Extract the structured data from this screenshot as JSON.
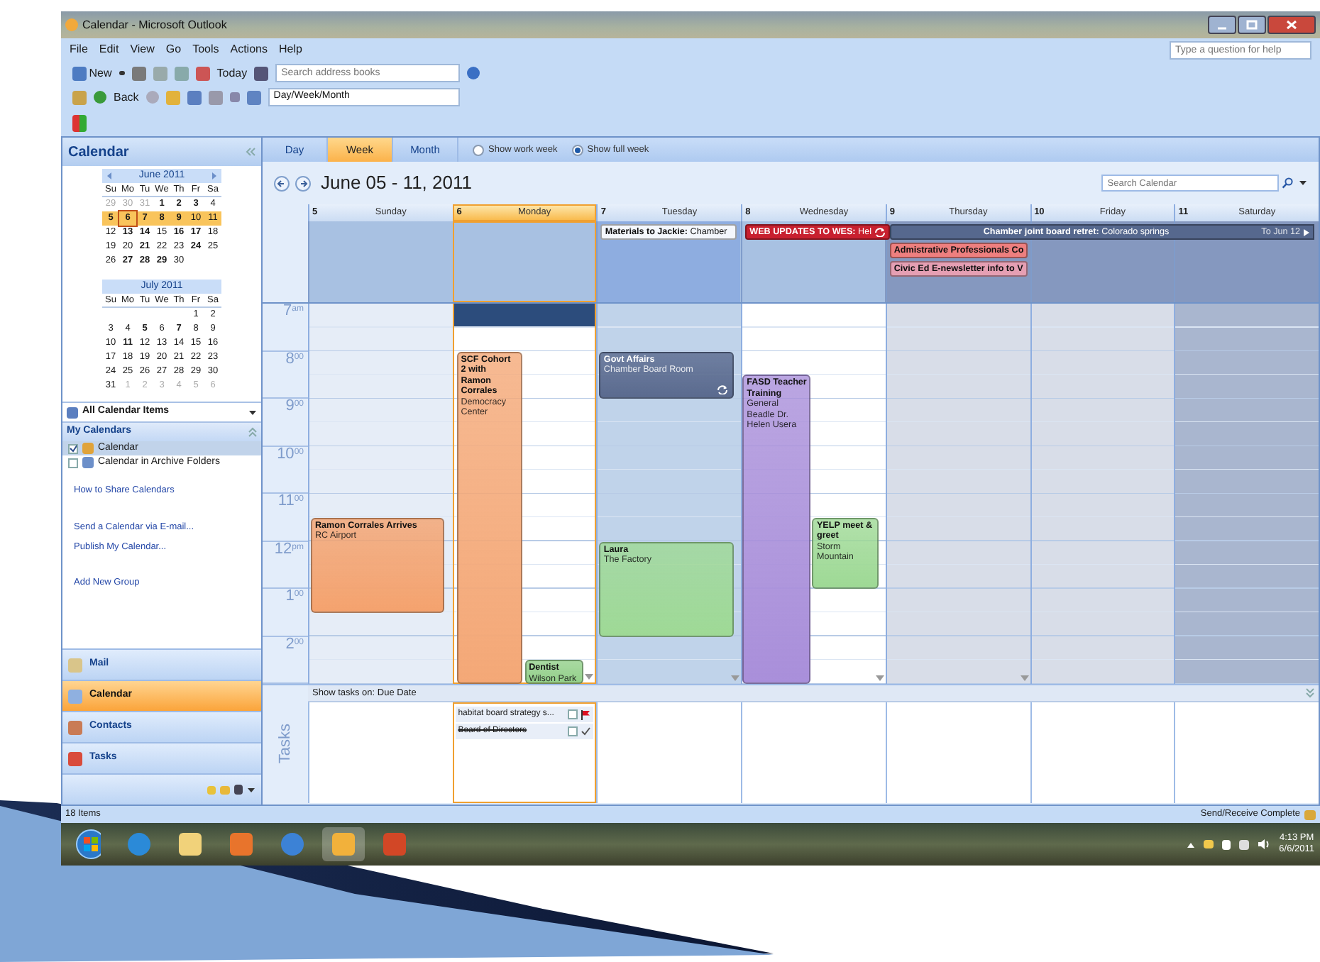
{
  "window": {
    "title": "Calendar - Microsoft Outlook"
  },
  "menu": [
    "File",
    "Edit",
    "View",
    "Go",
    "Tools",
    "Actions",
    "Help"
  ],
  "help_search": {
    "placeholder": "Type a question for help"
  },
  "toolbar_1": {
    "new": "New",
    "today": "Today",
    "address_search": {
      "placeholder": "Search address books"
    }
  },
  "toolbar_2": {
    "back": "Back",
    "view_select": "Day/Week/Month"
  },
  "nav_pane": {
    "title": "Calendar",
    "mini_calendars": [
      {
        "month": "June 2011",
        "weekdays": [
          "Su",
          "Mo",
          "Tu",
          "We",
          "Th",
          "Fr",
          "Sa"
        ],
        "weeks": [
          {
            "selected": false,
            "days": [
              {
                "day": "29",
                "muted": true,
                "bold": false,
                "today": false
              },
              {
                "day": "30",
                "muted": true,
                "bold": false,
                "today": false
              },
              {
                "day": "31",
                "muted": true,
                "bold": false,
                "today": false
              },
              {
                "day": "1",
                "muted": false,
                "bold": true,
                "today": false
              },
              {
                "day": "2",
                "muted": false,
                "bold": true,
                "today": false
              },
              {
                "day": "3",
                "muted": false,
                "bold": true,
                "today": false
              },
              {
                "day": "4",
                "muted": false,
                "bold": false,
                "today": false
              }
            ]
          },
          {
            "selected": true,
            "days": [
              {
                "day": "5",
                "muted": false,
                "bold": true,
                "today": false
              },
              {
                "day": "6",
                "muted": false,
                "bold": true,
                "today": true
              },
              {
                "day": "7",
                "muted": false,
                "bold": true,
                "today": false
              },
              {
                "day": "8",
                "muted": false,
                "bold": true,
                "today": false
              },
              {
                "day": "9",
                "muted": false,
                "bold": true,
                "today": false
              },
              {
                "day": "10",
                "muted": false,
                "bold": false,
                "today": false
              },
              {
                "day": "11",
                "muted": false,
                "bold": false,
                "today": false
              }
            ]
          },
          {
            "selected": false,
            "days": [
              {
                "day": "12",
                "muted": false,
                "bold": false,
                "today": false
              },
              {
                "day": "13",
                "muted": false,
                "bold": true,
                "today": false
              },
              {
                "day": "14",
                "muted": false,
                "bold": true,
                "today": false
              },
              {
                "day": "15",
                "muted": false,
                "bold": false,
                "today": false
              },
              {
                "day": "16",
                "muted": false,
                "bold": true,
                "today": false
              },
              {
                "day": "17",
                "muted": false,
                "bold": true,
                "today": false
              },
              {
                "day": "18",
                "muted": false,
                "bold": false,
                "today": false
              }
            ]
          },
          {
            "selected": false,
            "days": [
              {
                "day": "19",
                "muted": false,
                "bold": false,
                "today": false
              },
              {
                "day": "20",
                "muted": false,
                "bold": false,
                "today": false
              },
              {
                "day": "21",
                "muted": false,
                "bold": true,
                "today": false
              },
              {
                "day": "22",
                "muted": false,
                "bold": false,
                "today": false
              },
              {
                "day": "23",
                "muted": false,
                "bold": false,
                "today": false
              },
              {
                "day": "24",
                "muted": false,
                "bold": true,
                "today": false
              },
              {
                "day": "25",
                "muted": false,
                "bold": false,
                "today": false
              }
            ]
          },
          {
            "selected": false,
            "days": [
              {
                "day": "26",
                "muted": false,
                "bold": false,
                "today": false
              },
              {
                "day": "27",
                "muted": false,
                "bold": true,
                "today": false
              },
              {
                "day": "28",
                "muted": false,
                "bold": true,
                "today": false
              },
              {
                "day": "29",
                "muted": false,
                "bold": true,
                "today": false
              },
              {
                "day": "30",
                "muted": false,
                "bold": false,
                "today": false
              }
            ]
          }
        ]
      },
      {
        "month": "July 2011",
        "weekdays": [
          "Su",
          "Mo",
          "Tu",
          "We",
          "Th",
          "Fr",
          "Sa"
        ],
        "weeks": [
          {
            "selected": false,
            "days": [
              {
                "day": "1",
                "muted": false,
                "bold": false,
                "today": false
              },
              {
                "day": "2",
                "muted": false,
                "bold": false,
                "today": false
              }
            ]
          },
          {
            "selected": false,
            "days": [
              {
                "day": "3",
                "muted": false,
                "bold": false,
                "today": false
              },
              {
                "day": "4",
                "muted": false,
                "bold": false,
                "today": false
              },
              {
                "day": "5",
                "muted": false,
                "bold": true,
                "today": false
              },
              {
                "day": "6",
                "muted": false,
                "bold": false,
                "today": false
              },
              {
                "day": "7",
                "muted": false,
                "bold": true,
                "today": false
              },
              {
                "day": "8",
                "muted": false,
                "bold": false,
                "today": false
              },
              {
                "day": "9",
                "muted": false,
                "bold": false,
                "today": false
              }
            ]
          },
          {
            "selected": false,
            "days": [
              {
                "day": "10",
                "muted": false,
                "bold": false,
                "today": false
              },
              {
                "day": "11",
                "muted": false,
                "bold": true,
                "today": false
              },
              {
                "day": "12",
                "muted": false,
                "bold": false,
                "today": false
              },
              {
                "day": "13",
                "muted": false,
                "bold": false,
                "today": false
              },
              {
                "day": "14",
                "muted": false,
                "bold": false,
                "today": false
              },
              {
                "day": "15",
                "muted": false,
                "bold": false,
                "today": false
              },
              {
                "day": "16",
                "muted": false,
                "bold": false,
                "today": false
              }
            ]
          },
          {
            "selected": false,
            "days": [
              {
                "day": "17",
                "muted": false,
                "bold": false,
                "today": false
              },
              {
                "day": "18",
                "muted": false,
                "bold": false,
                "today": false
              },
              {
                "day": "19",
                "muted": false,
                "bold": false,
                "today": false
              },
              {
                "day": "20",
                "muted": false,
                "bold": false,
                "today": false
              },
              {
                "day": "21",
                "muted": false,
                "bold": false,
                "today": false
              },
              {
                "day": "22",
                "muted": false,
                "bold": false,
                "today": false
              },
              {
                "day": "23",
                "muted": false,
                "bold": false,
                "today": false
              }
            ]
          },
          {
            "selected": false,
            "days": [
              {
                "day": "24",
                "muted": false,
                "bold": false,
                "today": false
              },
              {
                "day": "25",
                "muted": false,
                "bold": false,
                "today": false
              },
              {
                "day": "26",
                "muted": false,
                "bold": false,
                "today": false
              },
              {
                "day": "27",
                "muted": false,
                "bold": false,
                "today": false
              },
              {
                "day": "28",
                "muted": false,
                "bold": false,
                "today": false
              },
              {
                "day": "29",
                "muted": false,
                "bold": false,
                "today": false
              },
              {
                "day": "30",
                "muted": false,
                "bold": false,
                "today": false
              }
            ]
          },
          {
            "selected": false,
            "days": [
              {
                "day": "31",
                "muted": false,
                "bold": false,
                "today": false
              },
              {
                "day": "1",
                "muted": true,
                "bold": false,
                "today": false
              },
              {
                "day": "2",
                "muted": true,
                "bold": false,
                "today": false
              },
              {
                "day": "3",
                "muted": true,
                "bold": false,
                "today": false
              },
              {
                "day": "4",
                "muted": true,
                "bold": false,
                "today": false
              },
              {
                "day": "5",
                "muted": true,
                "bold": false,
                "today": false
              },
              {
                "day": "6",
                "muted": true,
                "bold": false,
                "today": false
              }
            ]
          }
        ]
      }
    ],
    "view_select": "All Calendar Items",
    "my_calendars": {
      "title": "My Calendars",
      "items": [
        {
          "label": "Calendar",
          "checked": true,
          "selected": true
        },
        {
          "label": "Calendar in Archive Folders",
          "checked": false,
          "selected": false
        }
      ]
    },
    "links": [
      "How to Share Calendars",
      "Send a Calendar via E-mail...",
      "Publish My Calendar...",
      "Add New Group"
    ],
    "nav_buttons": [
      {
        "label": "Mail",
        "selected": false
      },
      {
        "label": "Calendar",
        "selected": true
      },
      {
        "label": "Contacts",
        "selected": false
      },
      {
        "label": "Tasks",
        "selected": false
      }
    ]
  },
  "calendar": {
    "view_tabs": [
      {
        "label": "Day",
        "selected": false
      },
      {
        "label": "Week",
        "selected": true
      },
      {
        "label": "Month",
        "selected": false
      }
    ],
    "week_options": [
      {
        "label": "Show work week",
        "selected": false
      },
      {
        "label": "Show full week",
        "selected": true
      }
    ],
    "range_title": "June 05 - 11, 2011",
    "search": {
      "placeholder": "Search Calendar"
    },
    "days": [
      {
        "date": "5",
        "name": "Sunday",
        "selected": false,
        "more_below": false
      },
      {
        "date": "6",
        "name": "Monday",
        "selected": true,
        "more_below": true
      },
      {
        "date": "7",
        "name": "Tuesday",
        "selected": false,
        "more_below": true
      },
      {
        "date": "8",
        "name": "Wednesday",
        "selected": false,
        "more_below": true
      },
      {
        "date": "9",
        "name": "Thursday",
        "selected": false,
        "more_below": true
      },
      {
        "date": "10",
        "name": "Friday",
        "selected": false,
        "more_below": false
      },
      {
        "date": "11",
        "name": "Saturday",
        "selected": false,
        "more_below": false
      }
    ],
    "hours": [
      {
        "hour": "7",
        "suffix": "am"
      },
      {
        "hour": "8",
        "suffix": "00"
      },
      {
        "hour": "9",
        "suffix": "00"
      },
      {
        "hour": "10",
        "suffix": "00"
      },
      {
        "hour": "11",
        "suffix": "00"
      },
      {
        "hour": "12",
        "suffix": "pm"
      },
      {
        "hour": "1",
        "suffix": "00"
      },
      {
        "hour": "2",
        "suffix": "00"
      }
    ],
    "all_day_events": [
      {
        "text": "**Materials to Jackie:** Chamber",
        "color": "#f4f7fc",
        "recurring": false
      },
      {
        "text": "**WEB UPDATES TO WES:** Hel",
        "color": "#c8202f",
        "recurring": true
      },
      {
        "text": "**Chamber joint board retret:** Colorado springs",
        "until": "To Jun 12",
        "color": "#56688e",
        "recurring": false
      },
      {
        "text": "**Admistrative Professionals Co**",
        "color": "#ee7f7f",
        "recurring": false
      },
      {
        "text": "**Civic Ed E-newsletter info to V**",
        "color": "#e59fb3",
        "recurring": false
      }
    ],
    "events": [
      {
        "title": "SCF Cohort 2 with Ramon Corrales",
        "location": "Democracy Center",
        "color": "#f4a877",
        "recurring": false
      },
      {
        "title": "Dentist",
        "location": "Wilson Park",
        "color": "#93d08a",
        "recurring": false
      },
      {
        "title": "Ramon Corrales Arrives",
        "location": "RC Airport",
        "color": "#f4a26e",
        "recurring": false
      },
      {
        "title": "Govt Affairs",
        "location": "Chamber Board Room",
        "color": "#5a6a8e",
        "recurring": true
      },
      {
        "title": "Laura",
        "location": "The Factory",
        "color": "#9ed995",
        "recurring": false
      },
      {
        "title": "FASD Teacher Training",
        "location": "General Beadle Dr. Helen Usera",
        "color": "#a98fda",
        "recurring": false
      },
      {
        "title": "YELP meet & greet",
        "location": "Storm Mountain",
        "color": "#9ed995",
        "recurring": false
      }
    ],
    "tasks": {
      "label": "Tasks",
      "bar": "Show tasks on: Due Date",
      "items": [
        {
          "title": "habitat board strategy s...",
          "completed": false
        },
        {
          "title": "Board of Directors",
          "completed": true
        }
      ]
    }
  },
  "status_bar": {
    "items": "18 Items",
    "sync": "Send/Receive Complete"
  },
  "taskbar": {
    "time": "4:13 PM",
    "date": "6/6/2011"
  }
}
